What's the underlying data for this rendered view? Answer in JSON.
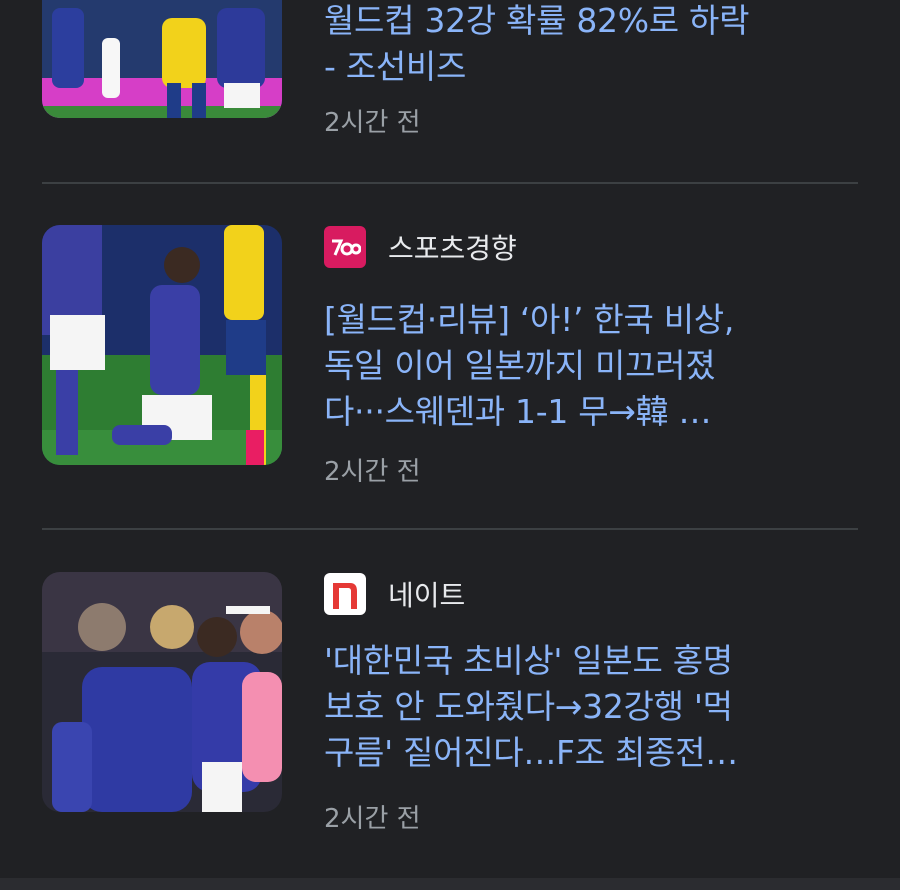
{
  "feed": {
    "articles": [
      {
        "headline_lines": [
          "월드컵 32강 확률 82%로 하락",
          "- 조선비즈"
        ],
        "time": "2시간 전"
      },
      {
        "source": "스포츠경향",
        "source_logo_color": "#d81b60",
        "headline_lines": [
          "[월드컵·리뷰] ‘아!’ 한국 비상,",
          "독일 이어 일본까지 미끄러졌",
          "다···스웨덴과 1-1 무→韓 …"
        ],
        "time": "2시간 전"
      },
      {
        "source": "네이트",
        "source_logo_color": "#e53935",
        "headline_lines": [
          "'대한민국 초비상' 일본도 홍명",
          "보호 안 도와줬다→32강행 '먹",
          "구름' 짙어진다…F조 최종전…"
        ],
        "time": "2시간 전"
      }
    ]
  },
  "colors": {
    "background": "#202124",
    "headline": "#8ab4f8",
    "source_text": "#e8eaed",
    "time_text": "#9aa0a6",
    "divider": "#3c4043"
  }
}
